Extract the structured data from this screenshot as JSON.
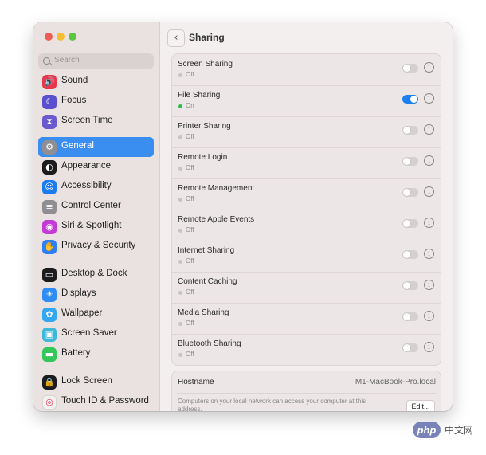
{
  "sidebar": {
    "search_placeholder": "Search",
    "items": [
      {
        "label": "Sound",
        "icon": "speaker-icon",
        "color": "#e8364f"
      },
      {
        "label": "Focus",
        "icon": "moon-icon",
        "color": "#5a4fcf"
      },
      {
        "label": "Screen Time",
        "icon": "hourglass-icon",
        "color": "#6a5acd"
      },
      {
        "label": "General",
        "icon": "gear-icon",
        "color": "#8e8e93",
        "selected": true
      },
      {
        "label": "Appearance",
        "icon": "appearance-icon",
        "color": "#1c1c1e"
      },
      {
        "label": "Accessibility",
        "icon": "accessibility-icon",
        "color": "#1a7cf0"
      },
      {
        "label": "Control Center",
        "icon": "control-center-icon",
        "color": "#8e8e93"
      },
      {
        "label": "Siri & Spotlight",
        "icon": "siri-icon",
        "color": "#c23bd4"
      },
      {
        "label": "Privacy & Security",
        "icon": "hand-icon",
        "color": "#2f7ef5"
      },
      {
        "label": "Desktop & Dock",
        "icon": "dock-icon",
        "color": "#1c1c1e"
      },
      {
        "label": "Displays",
        "icon": "displays-icon",
        "color": "#2f8cf5"
      },
      {
        "label": "Wallpaper",
        "icon": "wallpaper-icon",
        "color": "#35a7f2"
      },
      {
        "label": "Screen Saver",
        "icon": "screensaver-icon",
        "color": "#3fb8d9"
      },
      {
        "label": "Battery",
        "icon": "battery-icon",
        "color": "#34c759"
      },
      {
        "label": "Lock Screen",
        "icon": "lock-icon",
        "color": "#1c1c1e"
      },
      {
        "label": "Touch ID & Password",
        "icon": "fingerprint-icon",
        "color": "#f2f2f2"
      }
    ]
  },
  "header": {
    "back_icon": "chevron-left-icon",
    "title": "Sharing"
  },
  "services": [
    {
      "title": "Screen Sharing",
      "status": "Off",
      "enabled": false
    },
    {
      "title": "File Sharing",
      "status": "On",
      "enabled": true
    },
    {
      "title": "Printer Sharing",
      "status": "Off",
      "enabled": false
    },
    {
      "title": "Remote Login",
      "status": "Off",
      "enabled": false
    },
    {
      "title": "Remote Management",
      "status": "Off",
      "enabled": false
    },
    {
      "title": "Remote Apple Events",
      "status": "Off",
      "enabled": false
    },
    {
      "title": "Internet Sharing",
      "status": "Off",
      "enabled": false
    },
    {
      "title": "Content Caching",
      "status": "Off",
      "enabled": false
    },
    {
      "title": "Media Sharing",
      "status": "Off",
      "enabled": false
    },
    {
      "title": "Bluetooth Sharing",
      "status": "Off",
      "enabled": false
    }
  ],
  "hostname": {
    "label": "Hostname",
    "value": "M1-MacBook-Pro.local",
    "description": "Computers on your local network can access your computer at this address.",
    "edit_label": "Edit..."
  },
  "colors": {
    "accent": "#1e7ff0",
    "selection": "#3a8ef0",
    "status_on": "#2fbd4a"
  },
  "watermark": {
    "brand": "php",
    "text": "中文网"
  }
}
